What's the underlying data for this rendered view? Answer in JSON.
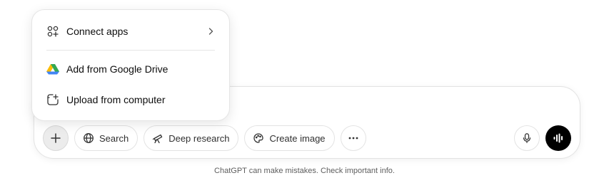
{
  "menu": {
    "items": [
      {
        "label": "Connect apps",
        "icon": "apps-grid-icon",
        "has_submenu": true
      },
      {
        "label": "Add from Google Drive",
        "icon": "google-drive-icon"
      },
      {
        "label": "Upload from computer",
        "icon": "upload-file-icon"
      }
    ]
  },
  "toolbar": {
    "add_icon": "plus-icon",
    "tools": [
      {
        "label": "Search",
        "icon": "globe-icon"
      },
      {
        "label": "Deep research",
        "icon": "telescope-icon"
      },
      {
        "label": "Create image",
        "icon": "palette-icon"
      }
    ],
    "more_icon": "ellipsis-icon",
    "mic_icon": "microphone-icon",
    "voice_icon": "voice-waveform-icon"
  },
  "footer": {
    "note": "ChatGPT can make mistakes. Check important info."
  },
  "colors": {
    "drive_yellow": "#FBBC04",
    "drive_green": "#34A853",
    "drive_blue": "#4285F4",
    "voice_bg": "#000000"
  }
}
